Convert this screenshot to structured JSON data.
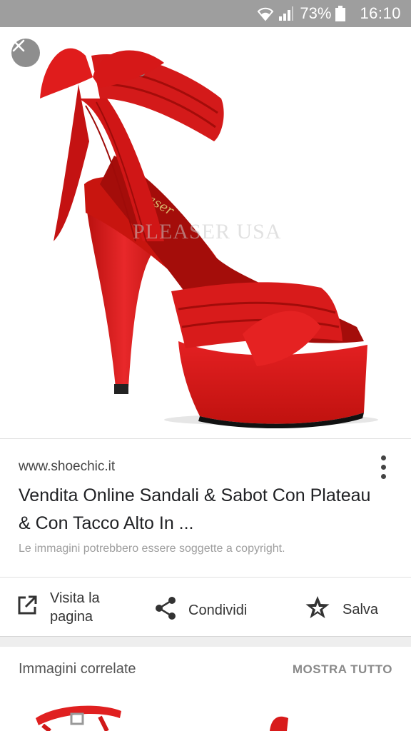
{
  "status_bar": {
    "battery_percent": "73%",
    "time": "16:10",
    "icons": [
      "wifi-icon",
      "signal-icon",
      "battery-icon"
    ]
  },
  "viewer": {
    "watermark": "PLEASER USA",
    "close_icon": "close-icon"
  },
  "result": {
    "source": "www.shoechic.it",
    "title": "Vendita Online Sandali & Sabot Con Plateau & Con Tacco Alto In ...",
    "copyright_notice": "Le immagini potrebbero essere soggette a copyright."
  },
  "actions": {
    "visit_label": "Visita la pagina",
    "share_label": "Condividi",
    "save_label": "Salva"
  },
  "related": {
    "title": "Immagini correlate",
    "show_all": "MOSTRA TUTTO"
  },
  "colors": {
    "status_bar": "#9e9e9e",
    "shoe_red": "#e0181b",
    "background": "#eeeeee"
  }
}
